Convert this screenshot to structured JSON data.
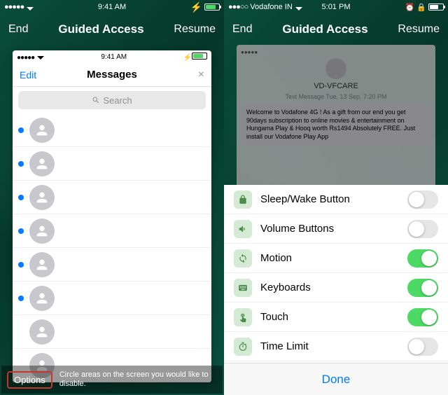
{
  "left": {
    "status": {
      "carrier_dots": "●●●●●",
      "time": "9:41 AM"
    },
    "guided_access": {
      "end": "End",
      "title": "Guided Access",
      "resume": "Resume"
    },
    "inner": {
      "status": {
        "dots": "●●●●●",
        "time": "9:41 AM"
      },
      "header": {
        "edit": "Edit",
        "title": "Messages",
        "close": "×"
      },
      "search": {
        "placeholder": "Search"
      },
      "rows_unread": [
        true,
        true,
        true,
        true,
        true,
        true,
        false,
        false
      ]
    },
    "bottom": {
      "options": "Options",
      "hint": "Circle areas on the screen you would like to disable."
    }
  },
  "right": {
    "status": {
      "carrier_dots": "●●●○○",
      "carrier": "Vodafone IN",
      "time": "5:01 PM"
    },
    "guided_access": {
      "end": "End",
      "title": "Guided Access",
      "resume": "Resume"
    },
    "dim": {
      "contact": "VD-VFCARE",
      "meta": "Text Message\nTue, 13 Sep, 7:20 PM",
      "bubble": "Welcome to Vodafone 4G ! As a gift from our end you get 90days subscription to online movies & entertainment on Hungama Play & Hooq worth Rs1494 Absolutely FREE. Just install our Vodafone Play App"
    },
    "options": [
      {
        "icon": "lock",
        "label": "Sleep/Wake Button",
        "on": false
      },
      {
        "icon": "volume",
        "label": "Volume Buttons",
        "on": false
      },
      {
        "icon": "motion",
        "label": "Motion",
        "on": true
      },
      {
        "icon": "keyboard",
        "label": "Keyboards",
        "on": true
      },
      {
        "icon": "touch",
        "label": "Touch",
        "on": true
      },
      {
        "icon": "timer",
        "label": "Time Limit",
        "on": false
      }
    ],
    "done": "Done"
  }
}
